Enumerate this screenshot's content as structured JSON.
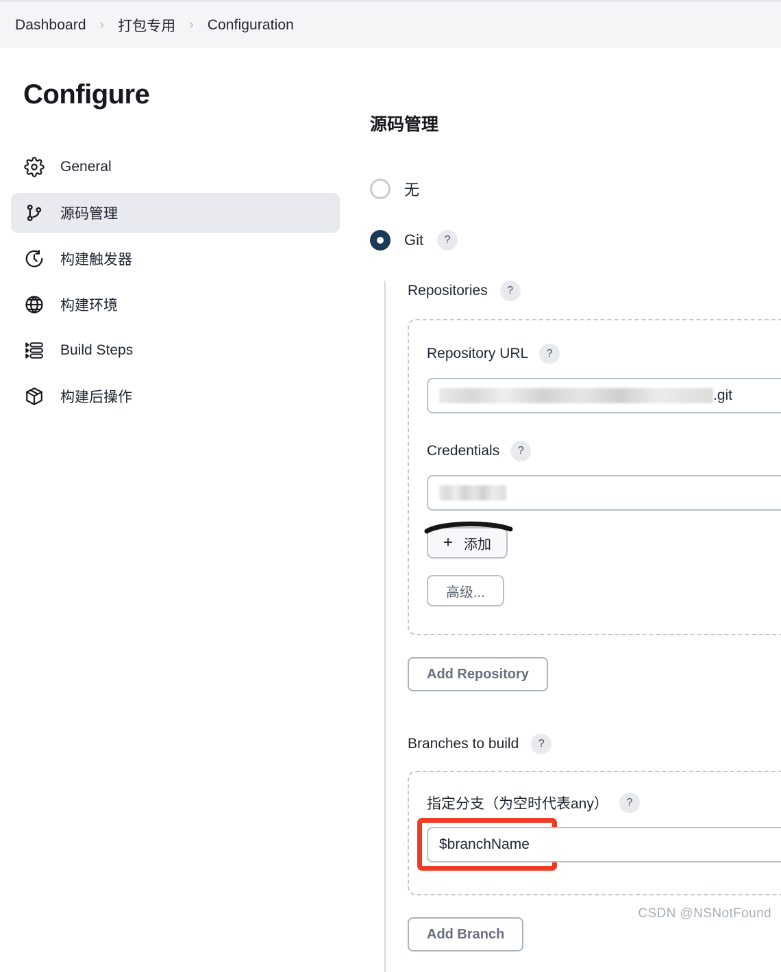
{
  "breadcrumb": {
    "items": [
      "Dashboard",
      "打包专用",
      "Configuration"
    ],
    "separator": "›"
  },
  "sidebar": {
    "title": "Configure",
    "items": [
      {
        "label": "General",
        "icon": "gear-icon",
        "active": false
      },
      {
        "label": "源码管理",
        "icon": "git-branch-icon",
        "active": true
      },
      {
        "label": "构建触发器",
        "icon": "clock-icon",
        "active": false
      },
      {
        "label": "构建环境",
        "icon": "globe-icon",
        "active": false
      },
      {
        "label": "Build Steps",
        "icon": "list-icon",
        "active": false
      },
      {
        "label": "构建后操作",
        "icon": "package-icon",
        "active": false
      }
    ]
  },
  "main": {
    "section_title": "源码管理",
    "scm_options": [
      {
        "label": "无",
        "selected": false,
        "has_help": false
      },
      {
        "label": "Git",
        "selected": true,
        "has_help": true
      }
    ],
    "repositories": {
      "label": "Repositories",
      "help": "?",
      "repository_url": {
        "label": "Repository URL",
        "help": "?",
        "value_redacted": true,
        "value_suffix": ".git"
      },
      "credentials": {
        "label": "Credentials",
        "help": "?",
        "value_redacted": true
      },
      "add_button": {
        "label": "添加",
        "plus": "+"
      },
      "advanced_button": {
        "label": "高级..."
      }
    },
    "add_repository_button": {
      "label": "Add Repository"
    },
    "branches": {
      "label": "Branches to build",
      "help": "?",
      "branch_specifier": {
        "label": "指定分支（为空时代表any）",
        "help": "?",
        "value": "$branchName",
        "highlighted": true
      }
    },
    "add_branch_button": {
      "label": "Add Branch"
    }
  },
  "watermark": "CSDN @NSNotFound",
  "colors": {
    "accent_navy": "#1b3a57",
    "highlight_red": "#ee3b24",
    "sidebar_active_bg": "#e8eaef",
    "breadcrumb_bg": "#f4f5f7",
    "dashed_border": "#c2c7cf"
  }
}
